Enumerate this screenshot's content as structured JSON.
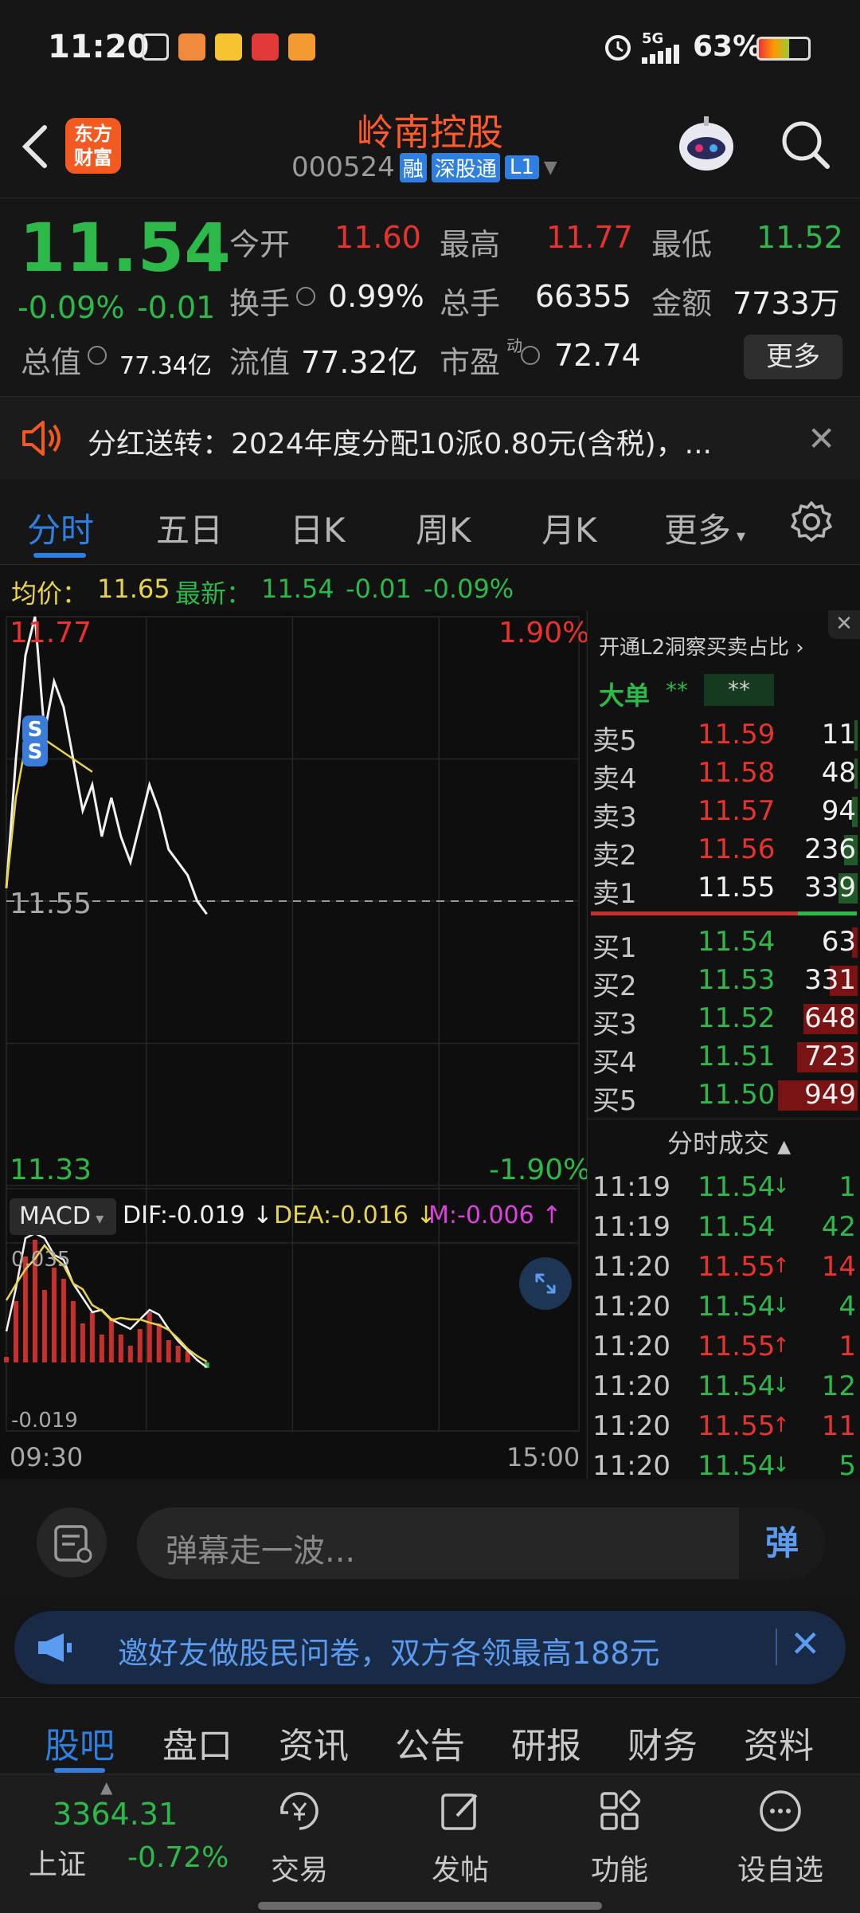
{
  "status_bar": {
    "time": "11:20",
    "network": "5G",
    "battery": "63%"
  },
  "header": {
    "logo_line1": "东方",
    "logo_line2": "财富",
    "stock_name": "岭南控股",
    "stock_code": "000524",
    "tag_margin": "融",
    "tag_connect": "深股通",
    "tag_level": "L1"
  },
  "quote": {
    "price": "11.54",
    "change_pct": "-0.09%",
    "change": "-0.01",
    "open_label": "今开",
    "open": "11.60",
    "high_label": "最高",
    "high": "11.77",
    "low_label": "最低",
    "low": "11.52",
    "turnover_label": "换手",
    "turnover": "0.99%",
    "volume_label": "总手",
    "volume": "66355",
    "amount_label": "金额",
    "amount": "7733万",
    "total_value_label": "总值",
    "total_value": "77.34亿",
    "float_value_label": "流值",
    "float_value": "77.32亿",
    "pe_label": "市盈",
    "pe_sup": "动",
    "pe": "72.74",
    "more_button": "更多"
  },
  "notice": {
    "text": "分红送转：2024年度分配10派0.80元(含税)，..."
  },
  "tabs": [
    "分时",
    "五日",
    "日K",
    "周K",
    "月K",
    "更多"
  ],
  "avg_line": {
    "avg_label": "均价：",
    "avg": "11.65",
    "latest_label": "最新：",
    "latest": "11.54",
    "change": "-0.01",
    "change_pct": "-0.09%"
  },
  "chart": {
    "y_high": "11.77",
    "y_mid": "11.55",
    "y_low": "11.33",
    "pct_high": "1.90%",
    "pct_low": "-1.90%",
    "macd_select": "MACD",
    "dif": "DIF:-0.019",
    "dea": "DEA:-0.016",
    "m": "M:-0.006",
    "macd_high": "0.035",
    "macd_low": "-0.019",
    "time_start": "09:30",
    "time_end": "15:00",
    "marker": "S"
  },
  "chart_data": {
    "type": "line",
    "title": "",
    "series": [
      {
        "name": "",
        "values": [
          11.56,
          11.66,
          11.74,
          11.77,
          11.68,
          11.72,
          11.7,
          11.66,
          11.62,
          11.64,
          11.6,
          11.63,
          11.6,
          11.58,
          11.61,
          11.64,
          11.62,
          11.59,
          11.58,
          11.57,
          11.55,
          11.54
        ]
      },
      {
        "name": "",
        "values": [
          11.56,
          11.63,
          11.67,
          11.68,
          11.675,
          11.67,
          11.665,
          11.66,
          11.655,
          11.65
        ]
      }
    ],
    "ylim": [
      11.33,
      11.77
    ],
    "y_ticks": [
      "11.77",
      "11.55",
      "11.33"
    ],
    "x_ticks": [
      "09:30",
      "15:00"
    ]
  },
  "orderbook": {
    "l2_link": "开通L2洞察买卖占比",
    "big_order_label": "大单",
    "big_order_value1": "**",
    "big_order_value2": "**",
    "asks": [
      {
        "label": "卖5",
        "price": "11.59",
        "vol": "11"
      },
      {
        "label": "卖4",
        "price": "11.58",
        "vol": "48"
      },
      {
        "label": "卖3",
        "price": "11.57",
        "vol": "94"
      },
      {
        "label": "卖2",
        "price": "11.56",
        "vol": "236"
      },
      {
        "label": "卖1",
        "price": "11.55",
        "vol": "339"
      }
    ],
    "bids": [
      {
        "label": "买1",
        "price": "11.54",
        "vol": "63"
      },
      {
        "label": "买2",
        "price": "11.53",
        "vol": "331"
      },
      {
        "label": "买3",
        "price": "11.52",
        "vol": "648"
      },
      {
        "label": "买4",
        "price": "11.51",
        "vol": "723"
      },
      {
        "label": "买5",
        "price": "11.50",
        "vol": "949"
      }
    ],
    "trades_header": "分时成交",
    "trades": [
      {
        "time": "11:19",
        "price": "11.54",
        "dir": "↓",
        "vol": "1",
        "color": "green"
      },
      {
        "time": "11:19",
        "price": "11.54",
        "dir": "",
        "vol": "42",
        "color": "green"
      },
      {
        "time": "11:20",
        "price": "11.55",
        "dir": "↑",
        "vol": "14",
        "color": "red"
      },
      {
        "time": "11:20",
        "price": "11.54",
        "dir": "↓",
        "vol": "4",
        "color": "green"
      },
      {
        "time": "11:20",
        "price": "11.55",
        "dir": "↑",
        "vol": "1",
        "color": "red"
      },
      {
        "time": "11:20",
        "price": "11.54",
        "dir": "↓",
        "vol": "12",
        "color": "green"
      },
      {
        "time": "11:20",
        "price": "11.55",
        "dir": "↑",
        "vol": "11",
        "color": "red"
      },
      {
        "time": "11:20",
        "price": "11.54",
        "dir": "↓",
        "vol": "5",
        "color": "green"
      }
    ]
  },
  "comment": {
    "placeholder": "弹幕走一波...",
    "send_label": "弹"
  },
  "promo": {
    "text": "邀好友做股民问卷，双方各领最高188元"
  },
  "bottom_tabs": [
    "股吧",
    "盘口",
    "资讯",
    "公告",
    "研报",
    "财务",
    "资料"
  ],
  "nav": {
    "index_value": "3364.31",
    "index_name": "上证",
    "index_change": "-0.72%",
    "trade": "交易",
    "post": "发帖",
    "function": "功能",
    "watchlist": "设自选"
  },
  "colors": {
    "up": "#e8332d",
    "down": "#2db84a",
    "accent": "#2f7fe0",
    "brand": "#f25a22"
  }
}
